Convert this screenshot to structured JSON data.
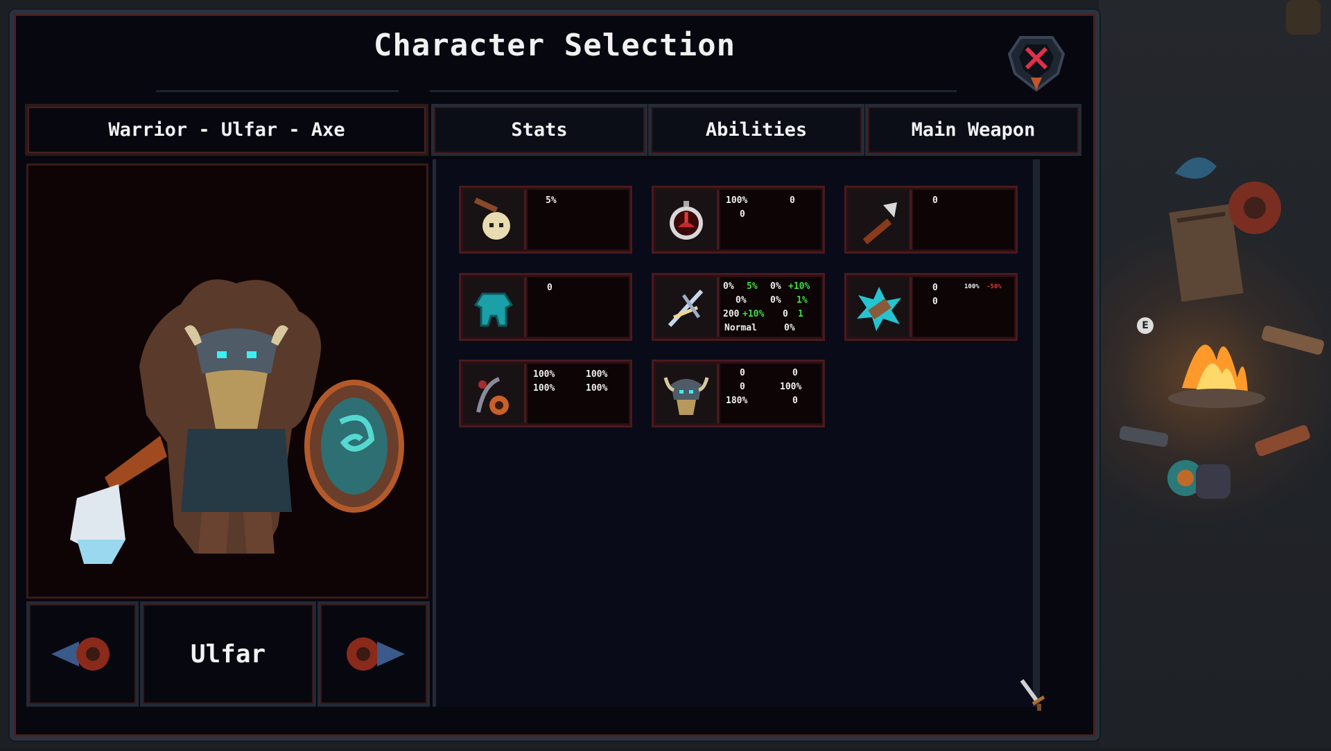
{
  "title": "Character Selection",
  "header": {
    "label": "Warrior - Ulfar - Axe"
  },
  "tabs": [
    {
      "label": "Stats"
    },
    {
      "label": "Abilities"
    },
    {
      "label": "Main Weapon"
    }
  ],
  "character": {
    "name": "Ulfar"
  },
  "stat_cards": [
    {
      "icon": "skull-axe-icon",
      "lines": [
        "5%"
      ]
    },
    {
      "icon": "stopwatch-icon",
      "lines": [
        "100%",
        "0",
        "0"
      ]
    },
    {
      "icon": "war-axe-icon",
      "lines": [
        "0"
      ]
    },
    {
      "icon": "armor-body-icon",
      "lines": [
        "0"
      ]
    },
    {
      "icon": "crossed-blades-icon",
      "lines": [
        "0%",
        "5%",
        "0%",
        "+10%",
        "0%",
        "0%",
        "1%",
        "200",
        "+10%",
        "0",
        "1",
        "Normal",
        "0%"
      ]
    },
    {
      "icon": "shattered-gauntlet-icon",
      "lines": [
        "0",
        "0",
        "100%",
        "-50%"
      ]
    },
    {
      "icon": "spiral-bow-icon",
      "lines": [
        "100%",
        "100%",
        "100%",
        "100%"
      ]
    },
    {
      "icon": "horned-helm-icon",
      "lines": [
        "0",
        "0",
        "0",
        "100%",
        "180%",
        "0"
      ]
    }
  ],
  "world": {
    "interact_key": "E"
  },
  "colors": {
    "panel_bg": "#07080f",
    "frame": "#2a3340",
    "accent_red": "#e0304a",
    "positive": "#3ee03e",
    "negative": "#e03a3a"
  }
}
